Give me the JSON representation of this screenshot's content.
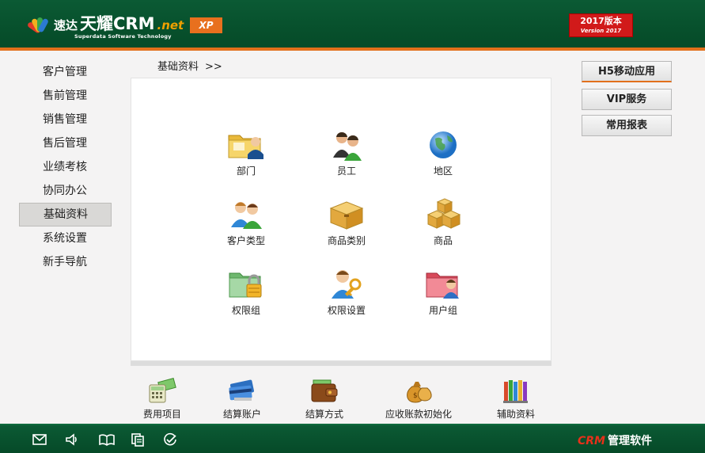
{
  "header": {
    "brand_prefix": "速达",
    "brand_main": "天耀CRM",
    "brand_suffix": ".net",
    "brand_sub": "Superdata Software Technology",
    "edition_badge": "XP",
    "version_line1": "2017版本",
    "version_line2": "Version 2017"
  },
  "nav": {
    "items": [
      {
        "label": "客户管理"
      },
      {
        "label": "售前管理"
      },
      {
        "label": "销售管理"
      },
      {
        "label": "售后管理"
      },
      {
        "label": "业绩考核"
      },
      {
        "label": "协同办公"
      },
      {
        "label": "基础资料",
        "active": true
      },
      {
        "label": "系统设置"
      },
      {
        "label": "新手导航"
      }
    ]
  },
  "breadcrumb": {
    "label": "基础资料",
    "separator": ">>"
  },
  "grid": [
    {
      "label": "部门",
      "icon": "folder-user-icon"
    },
    {
      "label": "员工",
      "icon": "users-icon"
    },
    {
      "label": "地区",
      "icon": "globe-icon"
    },
    {
      "label": "客户类型",
      "icon": "customers-icon"
    },
    {
      "label": "商品类别",
      "icon": "box-icon"
    },
    {
      "label": "商品",
      "icon": "boxes-icon"
    },
    {
      "label": "权限组",
      "icon": "folder-lock-icon"
    },
    {
      "label": "权限设置",
      "icon": "user-key-icon"
    },
    {
      "label": "用户组",
      "icon": "folder-user-red-icon"
    }
  ],
  "bottom_strip": [
    {
      "label": "费用项目",
      "icon": "calculator-money-icon"
    },
    {
      "label": "结算账户",
      "icon": "bank-cards-icon"
    },
    {
      "label": "结算方式",
      "icon": "wallet-icon"
    },
    {
      "label": "应收账款初始化",
      "icon": "money-bags-icon"
    },
    {
      "label": "辅助资料",
      "icon": "books-icon"
    }
  ],
  "right_buttons": [
    {
      "label": "H5移动应用"
    },
    {
      "label": "VIP服务"
    },
    {
      "label": "常用报表"
    }
  ],
  "footer": {
    "brand_crm": "CRM",
    "brand_text": "管理软件",
    "icons": [
      "mail-icon",
      "speaker-icon",
      "book-icon",
      "copy-icon",
      "check-circle-icon"
    ]
  }
}
